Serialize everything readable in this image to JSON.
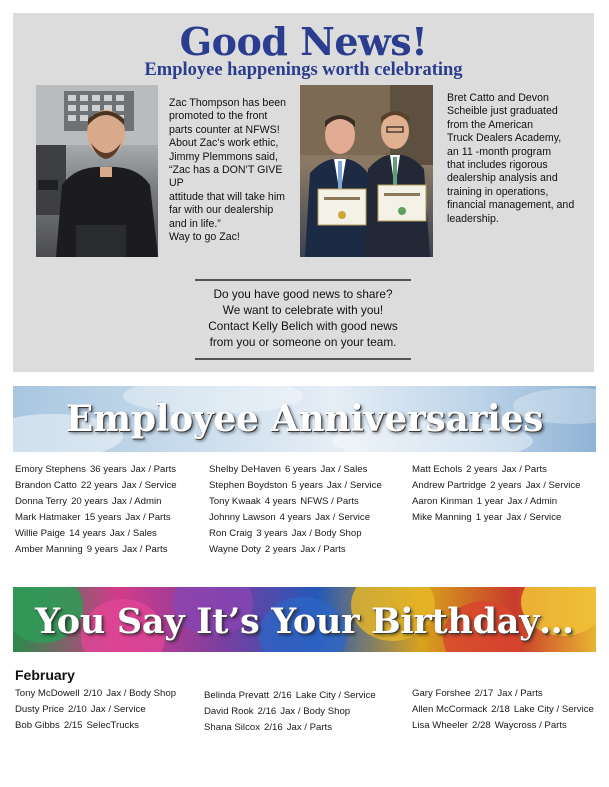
{
  "good_news": {
    "title": "Good News!",
    "subtitle": "Employee happenings worth celebrating",
    "story_zac": [
      "Zac Thompson has been",
      "promoted to the front",
      "parts counter at NFWS!",
      "About Zac’s work ethic,",
      "Jimmy Plemmons said,",
      "“Zac has a DON’T GIVE UP",
      "attitude that will take him",
      "far with our dealership",
      "and in life.”",
      "Way to go Zac!"
    ],
    "story_grads": [
      "Bret Catto and Devon",
      "Scheible just graduated",
      "from the American",
      "Truck Dealers Academy,",
      "an 11 -month program",
      "that includes rigorous",
      "dealership analysis and",
      "training in operations,",
      "financial management, and",
      "leadership."
    ],
    "share": [
      "Do you have good news to share?",
      "We want to celebrate with you!",
      "Contact Kelly Belich with good news",
      "from you or someone on your team."
    ]
  },
  "anniversaries": {
    "title": "Employee Anniversaries",
    "columns": [
      [
        {
          "name": "Emory Stephens",
          "years": "36 years",
          "location": "Jax / Parts"
        },
        {
          "name": "Brandon Catto",
          "years": "22 years",
          "location": "Jax / Service"
        },
        {
          "name": "Donna Terry",
          "years": "20 years",
          "location": "Jax / Admin"
        },
        {
          "name": "Mark Hatmaker",
          "years": "15 years",
          "location": "Jax / Parts"
        },
        {
          "name": "Willie Paige",
          "years": "14 years",
          "location": "Jax / Sales"
        },
        {
          "name": "Amber Manning",
          "years": "9 years",
          "location": "Jax / Parts"
        }
      ],
      [
        {
          "name": "Shelby DeHaven",
          "years": "6 years",
          "location": "Jax / Sales"
        },
        {
          "name": "Stephen Boydston",
          "years": "5 years",
          "location": "Jax / Service"
        },
        {
          "name": "Tony Kwaak",
          "years": "4 years",
          "location": "NFWS / Parts"
        },
        {
          "name": "Johnny Lawson",
          "years": "4 years",
          "location": "Jax / Service"
        },
        {
          "name": "Ron Craig",
          "years": "3 years",
          "location": "Jax / Body Shop"
        },
        {
          "name": "Wayne Doty",
          "years": "2 years",
          "location": "Jax / Parts"
        }
      ],
      [
        {
          "name": "Matt Echols",
          "years": "2 years",
          "location": "Jax / Parts"
        },
        {
          "name": "Andrew Partridge",
          "years": "2 years",
          "location": "Jax / Service"
        },
        {
          "name": "Aaron Kinman",
          "years": "1 year",
          "location": "Jax / Admin"
        },
        {
          "name": "Mike Manning",
          "years": "1 year",
          "location": "Jax / Service"
        }
      ]
    ]
  },
  "birthdays": {
    "title": "You Say It’s Your Birthday…",
    "month": "February",
    "columns": [
      [
        {
          "name": "Tony McDowell",
          "date": "2/10",
          "location": "Jax / Body Shop"
        },
        {
          "name": "Dusty Price",
          "date": "2/10",
          "location": "Jax / Service"
        },
        {
          "name": "Bob Gibbs",
          "date": "2/15",
          "location": "SelecTrucks"
        }
      ],
      [
        {
          "name": "Belinda Prevatt",
          "date": "2/16",
          "location": "Lake City / Service"
        },
        {
          "name": "David Rook",
          "date": "2/16",
          "location": "Jax / Body Shop"
        },
        {
          "name": "Shana Silcox",
          "date": "2/16",
          "location": "Jax / Parts"
        }
      ],
      [
        {
          "name": "Gary Forshee",
          "date": "2/17",
          "location": "Jax / Parts"
        },
        {
          "name": "Allen McCormack",
          "date": "2/18",
          "location": "Lake City / Service"
        },
        {
          "name": "Lisa Wheeler",
          "date": "2/28",
          "location": "Waycross / Parts"
        }
      ]
    ]
  }
}
